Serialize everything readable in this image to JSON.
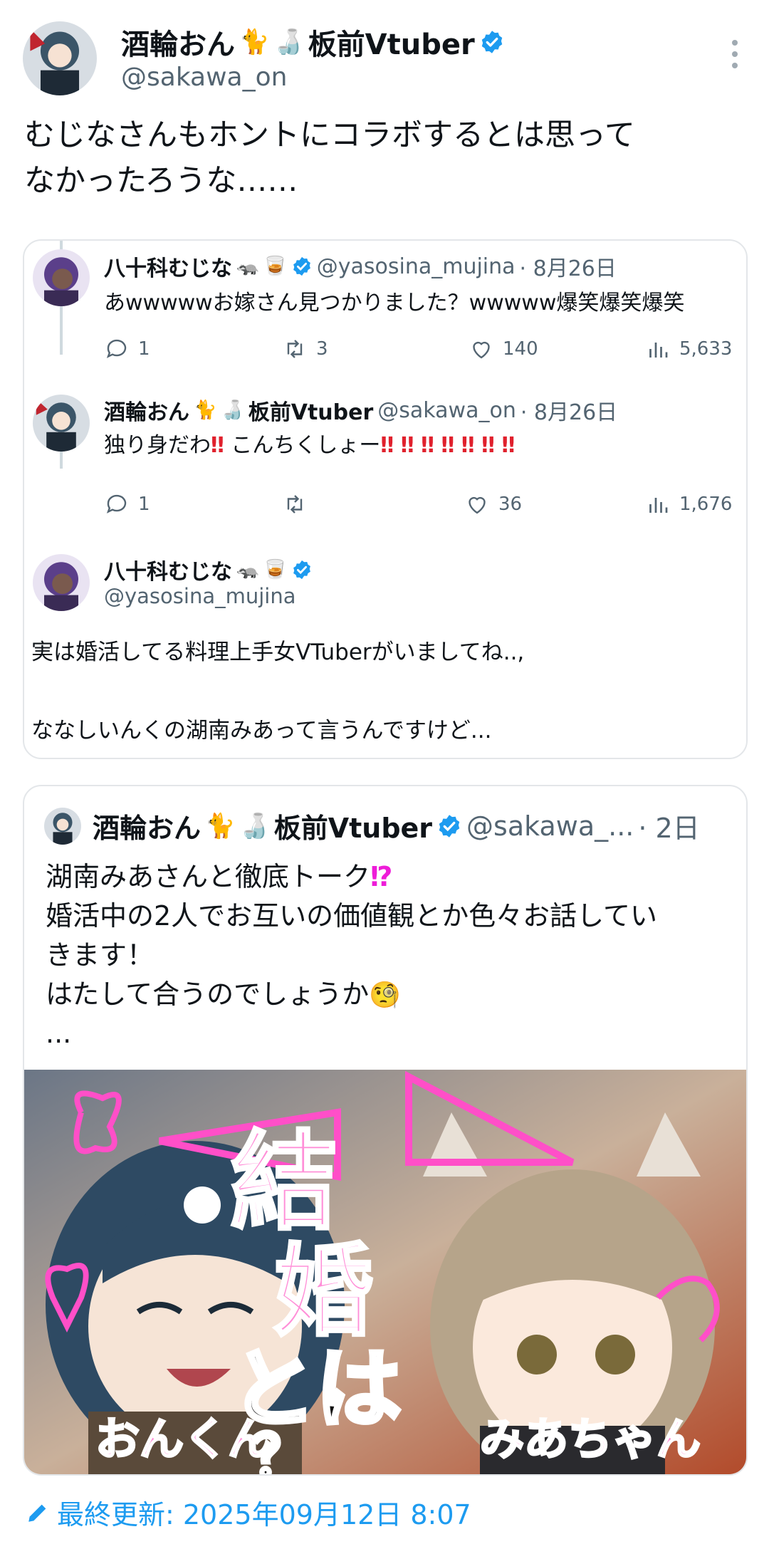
{
  "post": {
    "author_name": "酒輪おん",
    "author_name_suffix": "板前Vtuber",
    "author_handle": "@sakawa_on",
    "text_line1": "むじなさんもホントにコラボするとは思って",
    "text_line2": "なかったろうな……"
  },
  "thread": [
    {
      "name": "八十科むじな",
      "handle": "@yasosina_mujina",
      "date": "· 8月26日",
      "text": "あwwwwwお嫁さん見つかりました？wwwww爆笑爆笑爆笑",
      "replies": "1",
      "retweets": "3",
      "likes": "140",
      "views": "5,633"
    },
    {
      "name": "酒輪おん",
      "name_suffix": "板前Vtuber",
      "handle": "@sakawa_on",
      "date": "· 8月26日",
      "text_prefix": "独り身だわ",
      "text_mid": "こんちくしょー",
      "marks": "‼",
      "replies": "1",
      "retweets": "",
      "likes": "36",
      "views": "1,676"
    },
    {
      "name": "八十科むじな",
      "handle": "@yasosina_mujina",
      "text_line1": "実は婚活してる料理上手女VTuberがいましてね..,",
      "text_line2": "ななしいんくの湖南みあって言うんですけど..."
    }
  ],
  "quote": {
    "name": "酒輪おん",
    "name_suffix": "板前Vtuber",
    "handle": "@sakawa_...",
    "date": "· 2日",
    "line1": "湖南みあさんと徹底トーク",
    "line1_mark": "⁉",
    "line2": "婚活中の2人でお互いの価値観とか色々お話してい",
    "line3": "きます！",
    "line4": "はたして合うのでしょうか",
    "line5": "...",
    "thumbnail": {
      "title_1": "結",
      "title_2": "婚",
      "title_3": "とは",
      "title_4": "？",
      "left_label": "おんくん",
      "right_label": "みあちゃん"
    }
  },
  "footer": {
    "label": "最終更新: 2025年09月12日 8:07",
    "icon": "pencil-icon"
  },
  "colors": {
    "accent": "#1d9bf0",
    "secondary_text": "#536471",
    "neon_pink": "#ff4fc8"
  }
}
